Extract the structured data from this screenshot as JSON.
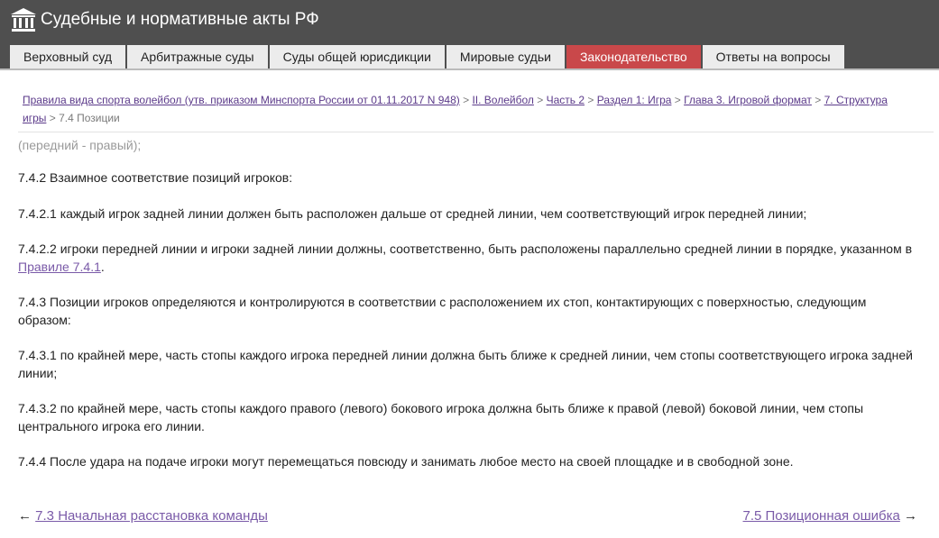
{
  "header": {
    "title": "Судебные и нормативные акты РФ",
    "logo_icon": "courthouse-icon"
  },
  "nav": {
    "tabs": [
      {
        "label": "Верховный суд",
        "active": false
      },
      {
        "label": "Арбитражные суды",
        "active": false
      },
      {
        "label": "Суды общей юрисдикции",
        "active": false
      },
      {
        "label": "Мировые судьи",
        "active": false
      },
      {
        "label": "Законодательство",
        "active": true
      },
      {
        "label": "Ответы на вопросы",
        "active": false
      }
    ],
    "active_color": "#c9484a"
  },
  "breadcrumb": {
    "links": [
      "Правила вида спорта волейбол (утв. приказом Минспорта России от 01.11.2017 N 948)",
      "II. Волейбол",
      "Часть 2",
      "Раздел 1: Игра",
      "Глава 3. Игровой формат",
      "7. Структура игры"
    ],
    "separator": ">",
    "current": "7.4 Позиции"
  },
  "content": {
    "p0": "(передний - правый);",
    "p1": "7.4.2 Взаимное соответствие позиций игроков:",
    "p2": "7.4.2.1 каждый игрок задней линии должен быть расположен дальше от средней линии, чем соответствующий игрок передней линии;",
    "p3_text": "7.4.2.2 игроки передней линии и игроки задней линии должны, соответственно, быть расположены параллельно средней линии в порядке, указанном в ",
    "p3_link": "Правиле 7.4.1",
    "p3_end": ".",
    "p4": "7.4.3 Позиции игроков определяются и контролируются в соответствии с расположением их стоп, контактирующих с поверхностью, следующим образом:",
    "p5": "7.4.3.1 по крайней мере, часть стопы каждого игрока передней линии должна быть ближе к средней линии, чем стопы соответствующего игрока задней линии;",
    "p6": "7.4.3.2 по крайней мере, часть стопы каждого правого (левого) бокового игрока должна быть ближе к правой (левой) боковой линии, чем стопы центрального игрока его линии.",
    "p7": "7.4.4 После удара на подаче игроки могут перемещаться повсюду и занимать любое место на своей площадке и в свободной зоне."
  },
  "pager": {
    "prev_arrow": "←",
    "prev_label": "7.3 Начальная расстановка команды",
    "next_label": "7.5 Позиционная ошибка",
    "next_arrow": "→"
  }
}
